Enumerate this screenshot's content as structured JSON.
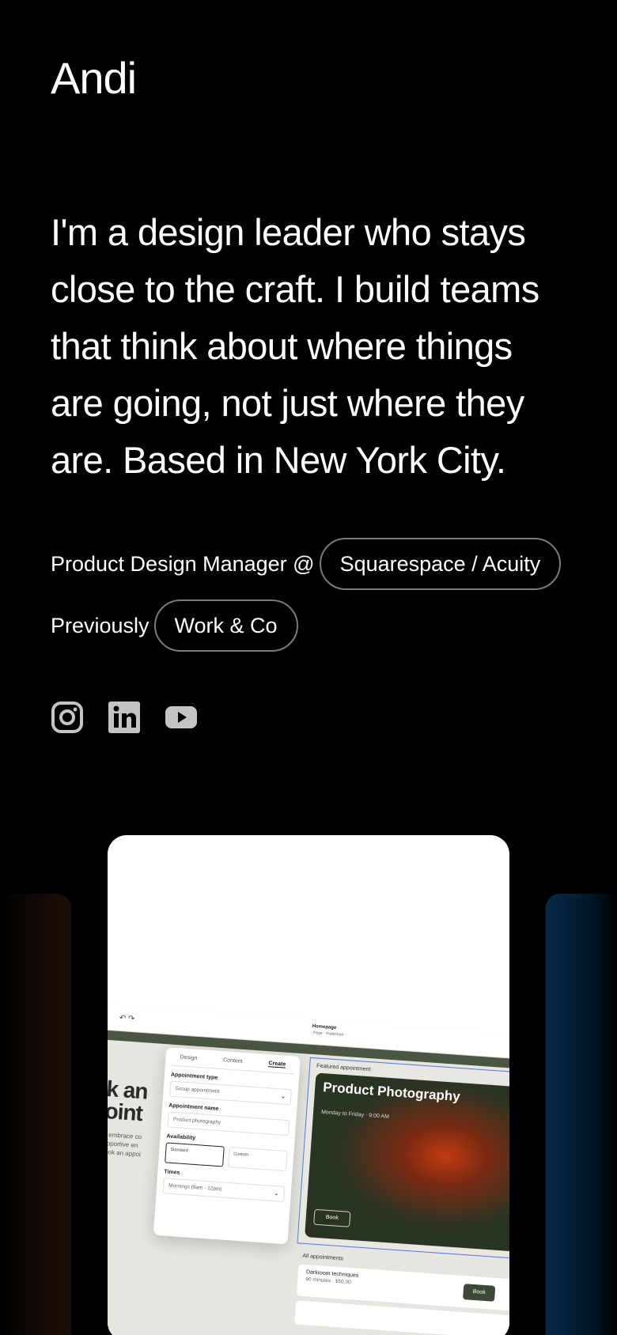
{
  "profile": {
    "name": "Andi",
    "bio": "I'm a design leader who stays close to the craft. I build teams that think about where things are going, not just where they are. Based in New York City."
  },
  "roles": {
    "current_prefix": "Product Design Manager @",
    "current_company": "Squarespace / Acuity",
    "previous_prefix": "Previously",
    "previous_company": "Work & Co"
  },
  "socials": [
    {
      "icon": "instagram-icon",
      "color": "#c4c4c4"
    },
    {
      "icon": "linkedin-icon",
      "color": "#c4c4c4"
    },
    {
      "icon": "youtube-icon",
      "color": "#c4c4c4"
    }
  ],
  "showcase": {
    "topbar": {
      "undo": "↶ ↷",
      "page_title": "Homepage",
      "page_status": "Page · Published"
    },
    "hero_text": "ok an\npoint",
    "hero_copy": ", we embrace co\na supportive en\ny. Book an appoi",
    "panel": {
      "tabs": [
        "Design",
        "Content",
        "Create"
      ],
      "active_tab": "Create",
      "appointment_type_label": "Appointment type",
      "appointment_type_value": "Group appointment",
      "appointment_name_label": "Appointment name",
      "appointment_name_value": "Product photography",
      "availability_label": "Availability",
      "availability_options": [
        "Standard",
        "Custom"
      ],
      "times_label": "Times",
      "times_value": "Mornings (9am - 12pm)"
    },
    "featured": {
      "label": "Featured appointment",
      "title": "Product Photography",
      "schedule": "Monday to Friday · 9:00 AM",
      "book_label": "Book"
    },
    "all_appointments": {
      "label": "All appointments",
      "items": [
        {
          "name": "Darkroom techniques",
          "meta": "90 minutes · $50.00",
          "book_label": "Book"
        }
      ]
    }
  },
  "colors": {
    "background": "#000000",
    "pill_border": "#7a7a7a",
    "accent_green": "#4a5642",
    "featured_border": "#4a7be0"
  }
}
